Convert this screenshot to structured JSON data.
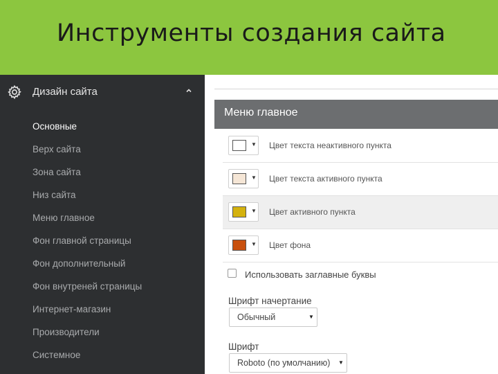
{
  "slide": {
    "title": "Инструменты создания сайта"
  },
  "sidebar": {
    "header": {
      "label": "Дизайн сайта",
      "icon": "gear-icon",
      "expand_icon": "chevron-up-icon"
    },
    "items": [
      {
        "label": "Основные",
        "active": true
      },
      {
        "label": "Верх сайта"
      },
      {
        "label": "Зона сайта"
      },
      {
        "label": "Низ сайта"
      },
      {
        "label": "Меню главное"
      },
      {
        "label": "Фон главной страницы"
      },
      {
        "label": "Фон дополнительный"
      },
      {
        "label": "Фон внутреней страницы"
      },
      {
        "label": "Интернет-магазин"
      },
      {
        "label": "Производители"
      },
      {
        "label": "Системное"
      }
    ]
  },
  "panel": {
    "title": "Меню главное",
    "color_rows": [
      {
        "label": "Цвет текста неактивного пункта",
        "color": "#ffffff"
      },
      {
        "label": "Цвет текста активного пункта",
        "color": "#f5e6d6"
      },
      {
        "label": "Цвет активного пункта",
        "color": "#d4b20f"
      },
      {
        "label": "Цвет фона",
        "color": "#c8500e"
      }
    ],
    "uppercase_checkbox": {
      "label": "Использовать заглавные буквы",
      "checked": false
    },
    "font_style": {
      "label": "Шрифт начертание",
      "value": "Обычный"
    },
    "font": {
      "label": "Шрифт",
      "value": "Roboto (по умолчанию)"
    }
  },
  "colors": {
    "banner_bg": "#8cc63f",
    "sidebar_bg": "#2d2f31",
    "panel_header_bg": "#6c6e70"
  }
}
